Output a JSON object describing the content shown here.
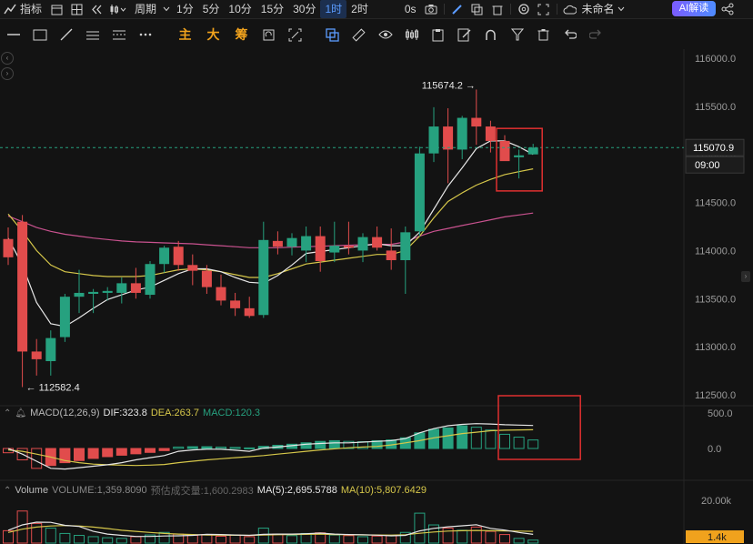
{
  "topbar": {
    "indicators_label": "指标",
    "period_label": "周期",
    "intervals": [
      "1分",
      "5分",
      "10分",
      "15分",
      "30分",
      "1时",
      "2时"
    ],
    "active_interval": "1时",
    "zero_seconds": "0s",
    "unnamed_label": "未命名",
    "ai_label": "AI解读"
  },
  "toolbar": {
    "main_label": "主",
    "big_label": "大",
    "chip_label": "筹"
  },
  "colors": {
    "up": "#26a17f",
    "down": "#e14c4c",
    "ma_white": "#e6e6e6",
    "ma_yellow": "#d6c74a",
    "ma_pink": "#c9528f",
    "highlight_box": "#e03030",
    "price_tag_bg": "#1c1c1c"
  },
  "chart_data": [
    {
      "type": "candlestick",
      "title": "",
      "interval": "1时",
      "ylim": [
        112350,
        116050
      ],
      "y_ticks": [
        "116000.0",
        "115500.0",
        "115000.0",
        "114500.0",
        "114000.0",
        "113500.0",
        "113000.0",
        "112500.0"
      ],
      "last_price": "115070.9",
      "countdown": "09:00",
      "high_annotation": "115674.2",
      "low_annotation": "112582.4",
      "candles": [
        {
          "o": 114120,
          "h": 114240,
          "l": 113850,
          "c": 113930
        },
        {
          "o": 114300,
          "h": 114370,
          "l": 112580,
          "c": 112950
        },
        {
          "o": 112950,
          "h": 113080,
          "l": 112700,
          "c": 112870
        },
        {
          "o": 112850,
          "h": 113170,
          "l": 112700,
          "c": 113090
        },
        {
          "o": 113100,
          "h": 113550,
          "l": 113050,
          "c": 113520
        },
        {
          "o": 113520,
          "h": 113800,
          "l": 113350,
          "c": 113560
        },
        {
          "o": 113550,
          "h": 113600,
          "l": 113350,
          "c": 113570
        },
        {
          "o": 113560,
          "h": 113620,
          "l": 113480,
          "c": 113580
        },
        {
          "o": 113560,
          "h": 113720,
          "l": 113450,
          "c": 113660
        },
        {
          "o": 113660,
          "h": 113820,
          "l": 113500,
          "c": 113560
        },
        {
          "o": 113540,
          "h": 113890,
          "l": 113500,
          "c": 113860
        },
        {
          "o": 113860,
          "h": 114050,
          "l": 113770,
          "c": 114030
        },
        {
          "o": 114040,
          "h": 114100,
          "l": 113790,
          "c": 113850
        },
        {
          "o": 113850,
          "h": 113960,
          "l": 113640,
          "c": 113790
        },
        {
          "o": 113790,
          "h": 113850,
          "l": 113550,
          "c": 113620
        },
        {
          "o": 113620,
          "h": 113750,
          "l": 113430,
          "c": 113480
        },
        {
          "o": 113480,
          "h": 113560,
          "l": 113320,
          "c": 113400
        },
        {
          "o": 113400,
          "h": 113520,
          "l": 113300,
          "c": 113320
        },
        {
          "o": 113330,
          "h": 114300,
          "l": 113300,
          "c": 114110
        },
        {
          "o": 114100,
          "h": 114200,
          "l": 113960,
          "c": 114040
        },
        {
          "o": 114040,
          "h": 114180,
          "l": 113950,
          "c": 114130
        },
        {
          "o": 114000,
          "h": 114250,
          "l": 113880,
          "c": 114150
        },
        {
          "o": 114150,
          "h": 114250,
          "l": 113780,
          "c": 113890
        },
        {
          "o": 113980,
          "h": 114300,
          "l": 113880,
          "c": 114050
        },
        {
          "o": 114050,
          "h": 114300,
          "l": 113960,
          "c": 114030
        },
        {
          "o": 114000,
          "h": 114180,
          "l": 113880,
          "c": 114140
        },
        {
          "o": 114140,
          "h": 114250,
          "l": 114000,
          "c": 114030
        },
        {
          "o": 114000,
          "h": 114230,
          "l": 113800,
          "c": 113900
        },
        {
          "o": 113900,
          "h": 114250,
          "l": 113550,
          "c": 114190
        },
        {
          "o": 114200,
          "h": 115080,
          "l": 114150,
          "c": 115010
        },
        {
          "o": 115010,
          "h": 115490,
          "l": 114920,
          "c": 115290
        },
        {
          "o": 115290,
          "h": 115480,
          "l": 114700,
          "c": 115050
        },
        {
          "o": 115050,
          "h": 115400,
          "l": 114950,
          "c": 115380
        },
        {
          "o": 115380,
          "h": 115674.2,
          "l": 115100,
          "c": 115290
        },
        {
          "o": 115290,
          "h": 115350,
          "l": 115020,
          "c": 115140
        },
        {
          "o": 115140,
          "h": 115200,
          "l": 114950,
          "c": 114930
        },
        {
          "o": 114970,
          "h": 115050,
          "l": 114750,
          "c": 114990
        },
        {
          "o": 115000,
          "h": 115110,
          "l": 115000,
          "c": 115070.9
        }
      ],
      "ma_white": [
        114130,
        113850,
        113460,
        113240,
        113210,
        113300,
        113400,
        113490,
        113540,
        113590,
        113620,
        113690,
        113760,
        113810,
        113810,
        113780,
        113720,
        113670,
        113660,
        113740,
        113850,
        113970,
        113990,
        114010,
        114030,
        114050,
        114070,
        114050,
        114050,
        114190,
        114430,
        114670,
        114860,
        115060,
        115140,
        115140,
        115080,
        115000
      ],
      "ma_yellow": [
        114380,
        114200,
        114000,
        113850,
        113780,
        113760,
        113740,
        113730,
        113730,
        113730,
        113740,
        113770,
        113800,
        113810,
        113800,
        113780,
        113750,
        113720,
        113720,
        113760,
        113810,
        113860,
        113880,
        113900,
        113920,
        113940,
        113960,
        113960,
        114000,
        114150,
        114340,
        114510,
        114600,
        114680,
        114740,
        114790,
        114820,
        114850
      ],
      "ma_pink": [
        114360,
        114300,
        114240,
        114200,
        114170,
        114150,
        114130,
        114115,
        114100,
        114090,
        114085,
        114080,
        114075,
        114070,
        114060,
        114050,
        114040,
        114030,
        114030,
        114030,
        114035,
        114040,
        114045,
        114050,
        114055,
        114060,
        114065,
        114065,
        114090,
        114150,
        114200,
        114230,
        114260,
        114290,
        114320,
        114350,
        114370,
        114390
      ]
    },
    {
      "type": "bar",
      "title": "MACD(12,26,9)",
      "dif_label": "DIF:323.8",
      "dea_label": "DEA:263.7",
      "macd_label": "MACD:120.3",
      "ylim": [
        -320,
        600
      ],
      "y_ticks": [
        "500.0",
        "0.0"
      ],
      "hist": [
        -60,
        -160,
        -280,
        -240,
        -200,
        -170,
        -140,
        -115,
        -95,
        -75,
        -55,
        -30,
        20,
        25,
        25,
        20,
        15,
        8,
        30,
        45,
        60,
        80,
        100,
        110,
        100,
        95,
        110,
        120,
        150,
        220,
        270,
        290,
        320,
        300,
        260,
        200,
        160,
        120
      ],
      "dif": [
        0,
        -80,
        -180,
        -280,
        -290,
        -270,
        -250,
        -230,
        -200,
        -160,
        -130,
        -100,
        -40,
        -20,
        -10,
        -10,
        -25,
        -40,
        5,
        20,
        40,
        60,
        70,
        80,
        80,
        90,
        100,
        110,
        140,
        220,
        280,
        320,
        340,
        350,
        345,
        335,
        330,
        324
      ],
      "dea": [
        -20,
        -40,
        -80,
        -120,
        -170,
        -200,
        -220,
        -230,
        -235,
        -240,
        -235,
        -225,
        -200,
        -180,
        -160,
        -145,
        -130,
        -115,
        -100,
        -80,
        -60,
        -40,
        -20,
        -5,
        10,
        20,
        30,
        50,
        80,
        110,
        150,
        180,
        210,
        230,
        250,
        258,
        262,
        264
      ]
    },
    {
      "type": "bar",
      "title": "Volume",
      "volume_label": "VOLUME:1,359.8090",
      "forecast_label": "预估成交量:1,600.2983",
      "ma5_label": "MA(5):2,695.5788",
      "ma10_label": "MA(10):5,807.6429",
      "ylim": [
        0,
        22000
      ],
      "y_ticks": [
        "20.00k"
      ],
      "current_tag": "1.4k",
      "values": [
        5800,
        15000,
        9200,
        7000,
        4500,
        3600,
        3000,
        2500,
        2200,
        3000,
        3800,
        5000,
        4200,
        3600,
        4000,
        3200,
        3800,
        3000,
        7000,
        4200,
        3500,
        4500,
        4800,
        3800,
        3500,
        3000,
        3300,
        3500,
        5000,
        14000,
        8500,
        7000,
        6000,
        7500,
        5500,
        4000,
        2200,
        1400
      ],
      "ma5": [
        6000,
        8500,
        9800,
        9700,
        8300,
        7800,
        5500,
        4200,
        3600,
        3100,
        3100,
        3300,
        3400,
        3600,
        4100,
        4000,
        3800,
        3600,
        4100,
        4200,
        4200,
        4400,
        4700,
        4200,
        4000,
        3900,
        3700,
        3400,
        3600,
        5700,
        6900,
        7600,
        8100,
        8600,
        6900,
        6100,
        5000,
        4100
      ],
      "ma10": [
        5000,
        6500,
        7500,
        8000,
        8200,
        8000,
        7500,
        6800,
        6000,
        5500,
        5000,
        4500,
        4200,
        4000,
        3800,
        3700,
        3650,
        3600,
        3800,
        3900,
        4000,
        4100,
        4200,
        4000,
        3900,
        3850,
        3800,
        3750,
        3900,
        4600,
        5200,
        5600,
        5800,
        5900,
        5800,
        5700,
        5600,
        5500
      ]
    }
  ]
}
